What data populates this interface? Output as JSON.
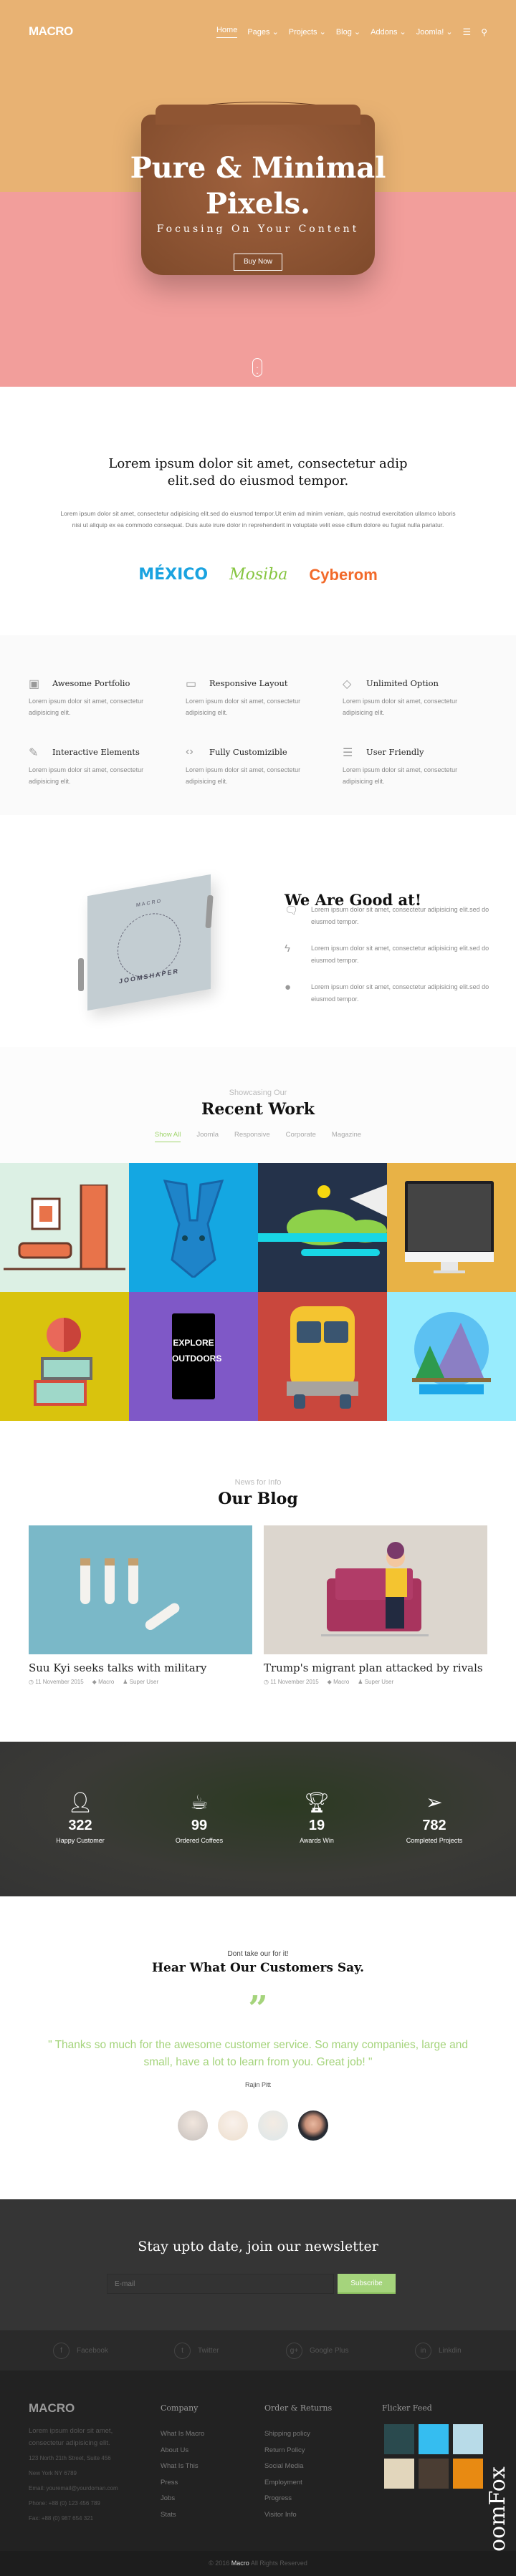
{
  "nav": {
    "logo": "MACRO",
    "items": [
      "Home",
      "Pages",
      "Projects",
      "Blog",
      "Addons",
      "Joomla!"
    ],
    "active": "Home"
  },
  "hero": {
    "title_line1": "Pure & Minimal",
    "title_line2": "Pixels.",
    "subtitle": "Focusing On Your Content",
    "button": "Buy Now"
  },
  "intro": {
    "heading_line1": "Lorem ipsum dolor sit amet, consectetur adip",
    "heading_line2": "elit.sed do eiusmod tempor.",
    "paragraph": "Lorem ipsum dolor sit amet, consectetur adipisicing elit.sed do eiusmod tempor.Ut enim ad minim veniam, quis nostrud exercitation ullamco laboris nisi ut aliquip ex ea commodo consequat. Duis aute irure dolor in reprehenderit in voluptate velit esse cillum dolore eu fugiat nulla pariatur.",
    "logos": [
      {
        "text": "MÉXICO",
        "color": "#1aa3e0"
      },
      {
        "text": "Mosiba",
        "color": "#86c540"
      },
      {
        "text": "Cyberom",
        "color": "#f26a2a"
      }
    ]
  },
  "features": [
    {
      "icon": "portfolio-icon",
      "title": "Awesome Portfolio",
      "desc": "Lorem ipsum dolor sit amet, consectetur adipisicing elit."
    },
    {
      "icon": "monitor-icon",
      "title": "Responsive Layout",
      "desc": "Lorem ipsum dolor sit amet, consectetur adipisicing elit."
    },
    {
      "icon": "diamond-icon",
      "title": "Unlimited Option",
      "desc": "Lorem ipsum dolor sit amet, consectetur adipisicing elit."
    },
    {
      "icon": "edit-icon",
      "title": "Interactive Elements",
      "desc": "Lorem ipsum dolor sit amet, consectetur adipisicing elit."
    },
    {
      "icon": "code-icon",
      "title": "Fully Customizible",
      "desc": "Lorem ipsum dolor sit amet, consectetur adipisicing elit."
    },
    {
      "icon": "support-icon",
      "title": "User Friendly",
      "desc": "Lorem ipsum dolor sit amet, consectetur adipisicing elit."
    }
  ],
  "good": {
    "book_title": "MACRO",
    "book_brand": "JOOMSHAPER",
    "heading": "We Are Good at!",
    "items": [
      {
        "icon": "chat-icon",
        "text": "Lorem ipsum dolor sit amet, consectetur adipisicing elit.sed do eiusmod tempor."
      },
      {
        "icon": "bolt-icon",
        "text": "Lorem ipsum dolor sit amet, consectetur adipisicing elit.sed do eiusmod tempor."
      },
      {
        "icon": "spy-icon",
        "text": "Lorem ipsum dolor sit amet, consectetur adipisicing elit.sed do eiusmod tempor."
      }
    ]
  },
  "recent": {
    "subtitle": "Showcasing Our",
    "heading": "Recent Work",
    "filters": [
      "Show All",
      "Joomla",
      "Responsive",
      "Corporate",
      "Magazine"
    ],
    "active_filter": "Show All",
    "tiles": [
      {
        "bg": "#dcf0e4",
        "icon": "furniture"
      },
      {
        "bg": "#14a7e2",
        "icon": "rabbit"
      },
      {
        "bg": "#24324a",
        "icon": "landscape"
      },
      {
        "bg": "#e8b246",
        "icon": "monitor"
      },
      {
        "bg": "#d9c30d",
        "icon": "apple-books"
      },
      {
        "bg": "#7f58c7",
        "icon": "mug"
      },
      {
        "bg": "#c9473d",
        "icon": "bus"
      },
      {
        "bg": "#98ecfd",
        "icon": "mountain"
      }
    ],
    "mug_text": "EXPLORE OUTDOORS"
  },
  "blog": {
    "subtitle": "News for Info",
    "heading": "Our Blog",
    "posts": [
      {
        "title": "Suu Kyi seeks talks with military",
        "date": "11 November 2015",
        "category": "Macro",
        "author": "Super User",
        "bg": "#7ab8c8"
      },
      {
        "title": "Trump's migrant plan attacked by rivals",
        "date": "11 November 2015",
        "category": "Macro",
        "author": "Super User",
        "bg": "#dcd6ce"
      }
    ]
  },
  "counters": [
    {
      "icon": "user-icon",
      "value": "322",
      "label": "Happy Customer"
    },
    {
      "icon": "coffee-icon",
      "value": "99",
      "label": "Ordered Coffees"
    },
    {
      "icon": "trophy-icon",
      "value": "19",
      "label": "Awards Win"
    },
    {
      "icon": "paper-plane-icon",
      "value": "782",
      "label": "Completed Projects"
    }
  ],
  "testimonial": {
    "subtitle": "Dont take our for it!",
    "heading": "Hear What Our Customers Say.",
    "quote": "\" Thanks so much for the awesome customer service. So many companies, large and small, have a lot to learn from you. Great job! \"",
    "author": "Rajin Pitt",
    "accent": "#a5d47c"
  },
  "newsletter": {
    "heading": "Stay upto date, join our newsletter",
    "placeholder": "E-mail",
    "button": "Subscribe"
  },
  "social": [
    {
      "icon": "facebook-icon",
      "label": "Facebook"
    },
    {
      "icon": "twitter-icon",
      "label": "Twitter"
    },
    {
      "icon": "google-plus-icon",
      "label": "Google Plus"
    },
    {
      "icon": "linkedin-icon",
      "label": "Linkdin"
    }
  ],
  "footer": {
    "logo": "MACRO",
    "about": "Lorem ipsum dolor sit amet, consectetur adipisicing elit.",
    "address": [
      "123 North 21th Street, Suite 456",
      "New York NY 6789",
      "Email: youremail@yourdoman.com",
      "Phone: +88 (0) 123 456 789",
      "Fax: +88 (0) 987 654 321"
    ],
    "company": {
      "heading": "Company",
      "links": [
        "What Is Macro",
        "About Us",
        "What Is This",
        "Press",
        "Jobs",
        "Stats"
      ]
    },
    "orders": {
      "heading": "Order & Returns",
      "links": [
        "Shipping policy",
        "Return Policy",
        "Social Media",
        "Employment",
        "Progress",
        "Visitor Info"
      ]
    },
    "flickr": {
      "heading": "Flicker Feed",
      "thumbs": [
        "#2a4a4e",
        "#35bdf0",
        "#b8dbe8",
        "#e2d6bc",
        "#4a3d33",
        "#e88a12"
      ]
    },
    "copyright_pre": "© 2016",
    "copyright_brand": "Macro",
    "copyright_post": "All Rights Reserved",
    "watermark": "JoomFox CREATIVE WEB STUDIO"
  }
}
